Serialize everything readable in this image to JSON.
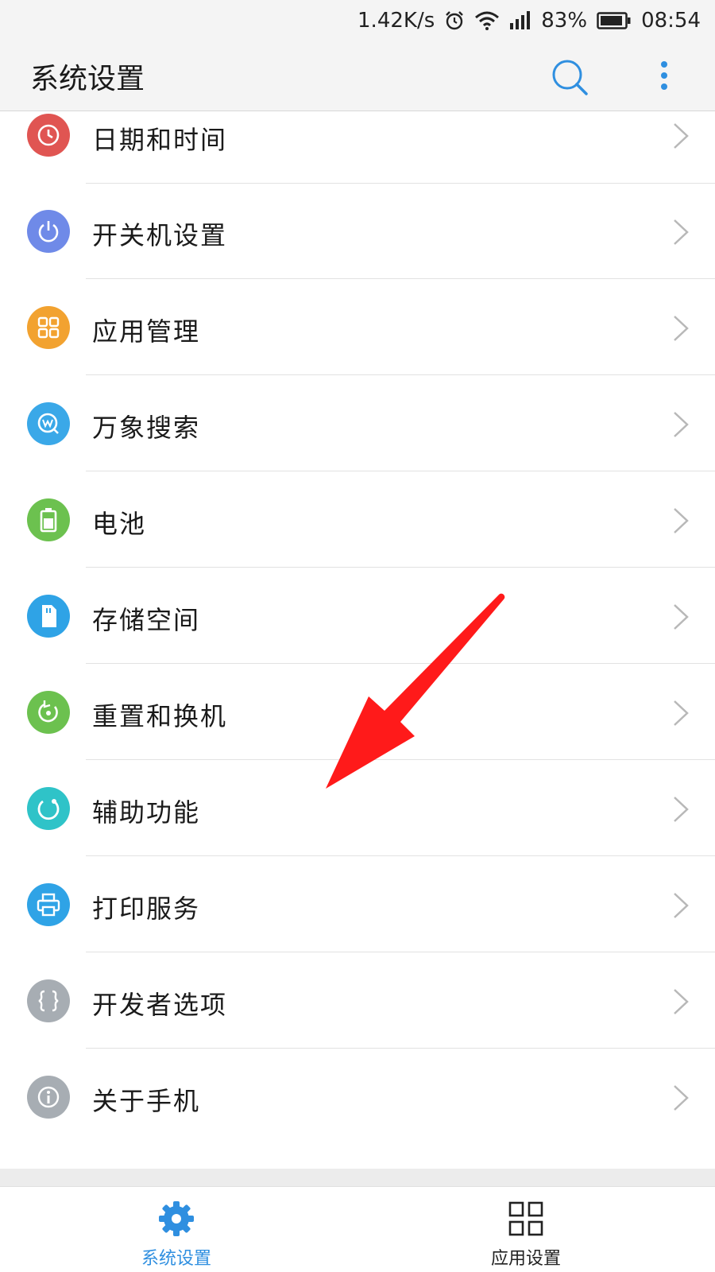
{
  "status_bar": {
    "net_speed": "1.42K/s",
    "battery_percent": "83%",
    "time": "08:54",
    "icons": [
      "alarm-icon",
      "wifi-icon",
      "signal-icon",
      "battery-icon"
    ]
  },
  "app_bar": {
    "title": "系统设置",
    "search_icon": "search-icon",
    "more_icon": "more-vert-icon"
  },
  "settings": {
    "items": [
      {
        "label": "日期和时间",
        "icon": "clock-icon",
        "color": "#e05552"
      },
      {
        "label": "开关机设置",
        "icon": "power-icon",
        "color": "#6f8ae8"
      },
      {
        "label": "应用管理",
        "icon": "apps-grid-icon",
        "color": "#f2a230"
      },
      {
        "label": "万象搜索",
        "icon": "search-w-icon",
        "color": "#3aa8e8"
      },
      {
        "label": "电池",
        "icon": "battery-icon",
        "color": "#6cc14f"
      },
      {
        "label": "存储空间",
        "icon": "sd-card-icon",
        "color": "#2fa3e6"
      },
      {
        "label": "重置和换机",
        "icon": "reset-icon",
        "color": "#6cc14f"
      },
      {
        "label": "辅助功能",
        "icon": "accessibility-icon",
        "color": "#2fc3c8"
      },
      {
        "label": "打印服务",
        "icon": "printer-icon",
        "color": "#2fa3e6"
      },
      {
        "label": "开发者选项",
        "icon": "braces-icon",
        "color": "#a7adb3"
      },
      {
        "label": "关于手机",
        "icon": "info-icon",
        "color": "#a7adb3"
      }
    ]
  },
  "bottom_nav": {
    "tabs": [
      {
        "label": "系统设置",
        "icon": "gear-icon",
        "active": true,
        "color": "#2f8fe0"
      },
      {
        "label": "应用设置",
        "icon": "apps-grid-icon",
        "active": false,
        "color": "#222222"
      }
    ]
  },
  "annotation": {
    "icon": "red-arrow-icon",
    "color": "#ff1a1a"
  }
}
